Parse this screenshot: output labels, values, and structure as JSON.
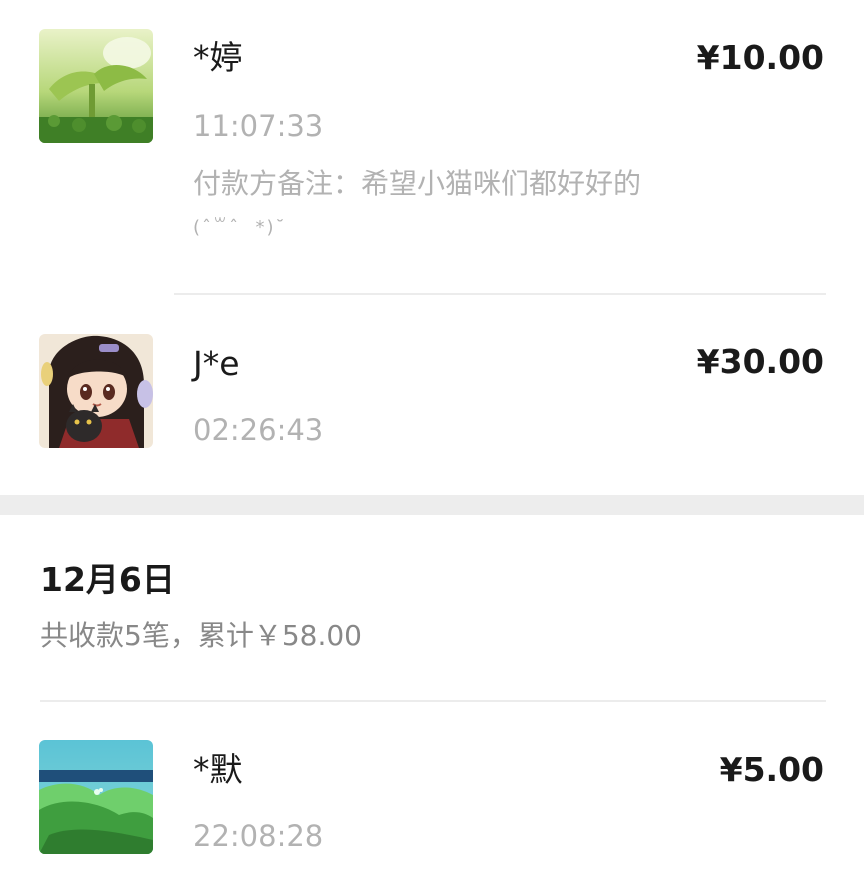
{
  "records": [
    {
      "name": "*婷",
      "amount": "¥10.00",
      "time": "11:07:33",
      "remark": "付款方备注：希望小猫咪们都好好的",
      "remark_emoticon": "(ˆ꒳ˆ  *)˘",
      "avatar_icon": "green-plant-avatar-icon"
    },
    {
      "name": "J*e",
      "amount": "¥30.00",
      "time": "02:26:43",
      "avatar_icon": "anime-girl-with-cat-avatar-icon"
    },
    {
      "name": "*默",
      "amount": "¥5.00",
      "time": "22:08:28",
      "avatar_icon": "ocean-wave-avatar-icon"
    }
  ],
  "day_section": {
    "date": "12月6日",
    "summary": "共收款5笔，累计￥58.00"
  },
  "colors": {
    "primary_text": "#1a1a1a",
    "secondary_text": "#b2b2b2",
    "summary_text": "#888888",
    "divider": "#ececec",
    "section_gap": "#ededed"
  }
}
